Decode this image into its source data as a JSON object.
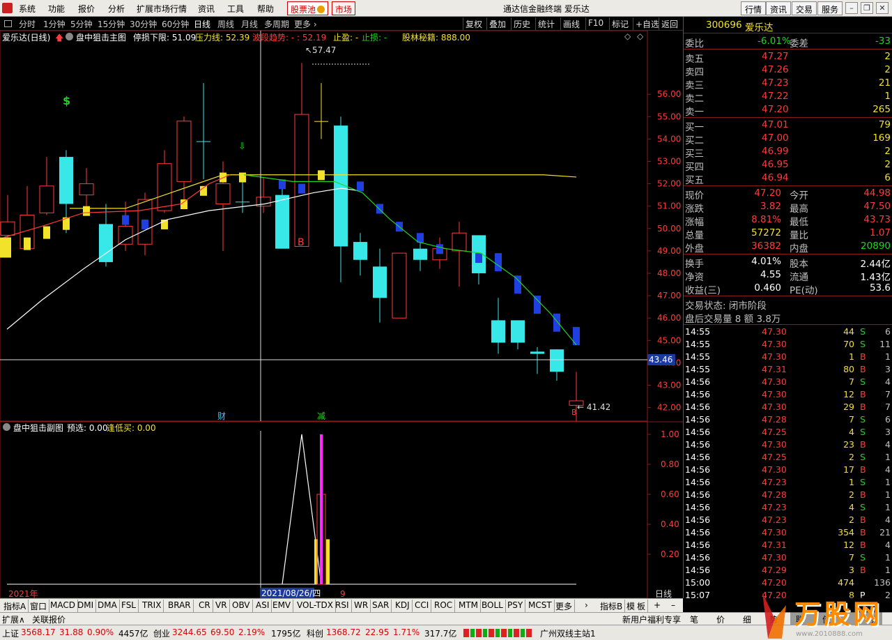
{
  "menu": [
    "系统",
    "功能",
    "报价",
    "分析",
    "扩展市场行情",
    "资讯",
    "工具",
    "帮助"
  ],
  "hot_label": "股票池",
  "market_label": "市场",
  "app_title": "通达信金融终端",
  "app_subtitle": "爱乐达",
  "top_right": [
    "行情",
    "资讯",
    "交易",
    "服务"
  ],
  "periods": [
    "分时",
    "1分钟",
    "5分钟",
    "15分钟",
    "30分钟",
    "60分钟",
    "日线",
    "周线",
    "月线",
    "多周期",
    "更多"
  ],
  "tools": [
    "复权",
    "叠加",
    "历史",
    "统计",
    "画线",
    "F10",
    "标记",
    "+自选",
    "返回"
  ],
  "info": {
    "name": "爱乐达(日线)",
    "indicator": "盘中狙击主图",
    "stoploss": "停损下限: 51.09",
    "pressure": "压力线: 52.39",
    "trend": "波段趋势: - : 52.19",
    "stop": "止盈: -",
    "stop2": "止损: -",
    "secret": "股林秘籍: 888.00"
  },
  "price_axis": [
    "56.00",
    "55.00",
    "54.00",
    "53.00",
    "52.00",
    "51.00",
    "50.00",
    "49.00",
    "48.00",
    "47.00",
    "46.00",
    "45.00",
    "44.00",
    "43.00",
    "42.00"
  ],
  "cursor_price": "43.46",
  "high_label": "57.47",
  "low_label": "41.42",
  "marks": {
    "dollar": "$",
    "buy": "B",
    "buy2": "B",
    "cai": "财",
    "jian": "减",
    "bs": "B"
  },
  "x_labels": {
    "year": "2021年",
    "date": "2021/08/26/四",
    "nine": "9",
    "period": "日线"
  },
  "sub": {
    "name": "盘中狙击副图",
    "yx": "预选: 0.00",
    "fdm": "逢低买: 0.00",
    "axis": [
      "1.00",
      "0.80",
      "0.60",
      "0.40",
      "0.20"
    ]
  },
  "tabs": [
    "指标A",
    "窗口",
    "MACD",
    "DMI",
    "DMA",
    "FSL",
    "TRIX",
    "BRAR",
    "CR",
    "VR",
    "OBV",
    "ASI",
    "EMV",
    "VOL-TDX",
    "RSI",
    "WR",
    "SAR",
    "KDJ",
    "CCI",
    "ROC",
    "MTM",
    "BOLL",
    "PSY",
    "MCST",
    "更多"
  ],
  "tabs_right": [
    "指标B",
    "模",
    "板"
  ],
  "bot2": {
    "left1": "扩展∧",
    "left2": "关联报价",
    "promo": "新用户福利专享",
    "btns": [
      "笔",
      "价",
      "细",
      "势",
      "联",
      "值",
      "筹"
    ]
  },
  "status": {
    "sh_name": "上证",
    "sh_val": "3568.17",
    "sh_chg": "31.88",
    "sh_pct": "0.90%",
    "sh_amt": "4457亿",
    "cy_name": "创业",
    "cy_val": "3244.65",
    "cy_chg": "69.50",
    "cy_pct": "2.19%",
    "cy_amt": "1795亿",
    "kc_name": "科创",
    "kc_val": "1368.72",
    "kc_chg": "22.95",
    "kc_pct": "1.71%",
    "kc_amt": "317.7亿",
    "station": "广州双线主站1"
  },
  "quote": {
    "code": "300696",
    "name": "爱乐达",
    "wb_label": "委比",
    "wb": "-6.01%",
    "wc_label": "委差",
    "wc": "-33",
    "sells": [
      {
        "l": "卖五",
        "p": "47.27",
        "v": "2"
      },
      {
        "l": "卖四",
        "p": "47.26",
        "v": "2"
      },
      {
        "l": "卖三",
        "p": "47.23",
        "v": "21"
      },
      {
        "l": "卖二",
        "p": "47.22",
        "v": "1"
      },
      {
        "l": "卖一",
        "p": "47.20",
        "v": "265"
      }
    ],
    "buys": [
      {
        "l": "买一",
        "p": "47.01",
        "v": "79"
      },
      {
        "l": "买二",
        "p": "47.00",
        "v": "169"
      },
      {
        "l": "买三",
        "p": "46.99",
        "v": "2"
      },
      {
        "l": "买四",
        "p": "46.95",
        "v": "2"
      },
      {
        "l": "买五",
        "p": "46.94",
        "v": "6"
      }
    ],
    "stats": [
      [
        "现价",
        "47.20",
        "今开",
        "44.98"
      ],
      [
        "涨跌",
        "3.82",
        "最高",
        "47.50"
      ],
      [
        "涨幅",
        "8.81%",
        "最低",
        "43.73"
      ],
      [
        "总量",
        "57272",
        "量比",
        "1.07"
      ],
      [
        "外盘",
        "36382",
        "内盘",
        "20890"
      ]
    ],
    "stats2": [
      [
        "换手",
        "4.01%",
        "股本",
        "2.44亿"
      ],
      [
        "净资",
        "4.55",
        "流通",
        "1.43亿"
      ],
      [
        "收益(三)",
        "0.460",
        "PE(动)",
        "53.6"
      ]
    ],
    "state": "交易状态: 闭市阶段",
    "after": "盘后交易量 8 额 3.8万"
  },
  "ticks": [
    [
      "14:55",
      "47.30",
      "44",
      "S",
      "6"
    ],
    [
      "14:55",
      "47.30",
      "70",
      "S",
      "11"
    ],
    [
      "14:55",
      "47.30",
      "1",
      "B",
      "1"
    ],
    [
      "14:55",
      "47.31",
      "80",
      "B",
      "3"
    ],
    [
      "14:56",
      "47.30",
      "7",
      "S",
      "4"
    ],
    [
      "14:56",
      "47.30",
      "12",
      "B",
      "7"
    ],
    [
      "14:56",
      "47.30",
      "29",
      "B",
      "7"
    ],
    [
      "14:56",
      "47.28",
      "7",
      "S",
      "6"
    ],
    [
      "14:56",
      "47.25",
      "4",
      "S",
      "3"
    ],
    [
      "14:56",
      "47.30",
      "23",
      "B",
      "4"
    ],
    [
      "14:56",
      "47.25",
      "2",
      "S",
      "1"
    ],
    [
      "14:56",
      "47.30",
      "17",
      "B",
      "4"
    ],
    [
      "14:56",
      "47.23",
      "1",
      "S",
      "1"
    ],
    [
      "14:56",
      "47.28",
      "2",
      "B",
      "1"
    ],
    [
      "14:56",
      "47.23",
      "4",
      "S",
      "1"
    ],
    [
      "14:56",
      "47.23",
      "2",
      "B",
      "4"
    ],
    [
      "14:56",
      "47.30",
      "354",
      "B",
      "21"
    ],
    [
      "14:56",
      "47.31",
      "12",
      "B",
      "4"
    ],
    [
      "14:56",
      "47.30",
      "7",
      "S",
      "1"
    ],
    [
      "14:56",
      "47.29",
      "3",
      "B",
      "1"
    ],
    [
      "15:00",
      "47.20",
      "474",
      "",
      "136"
    ],
    [
      "15:07",
      "47.20",
      "8",
      "P",
      "2"
    ]
  ],
  "watermark": {
    "text": "万股网",
    "url": "www.2010888.com"
  },
  "colors": {
    "up": "#ff3b3b",
    "down": "#38e8e8",
    "yellow": "#f2e22a",
    "blue": "#1f3fe0"
  }
}
